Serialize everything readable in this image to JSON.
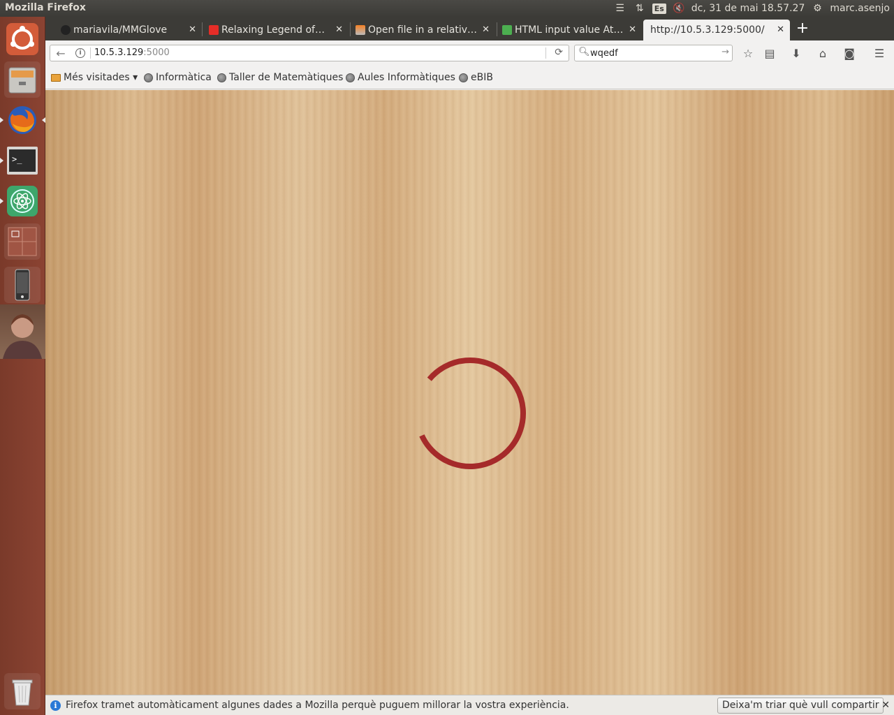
{
  "panel": {
    "app_title": "Mozilla Firefox",
    "language": "Es",
    "clock": "dc, 31 de mai 18.57.27",
    "user": "marc.asenjo"
  },
  "launcher": {
    "items": [
      "Ubuntu Dash",
      "Files",
      "Firefox",
      "Terminal",
      "Atom",
      "Workspace Switcher",
      "Device",
      "User Photo",
      "Trash"
    ]
  },
  "tabs": [
    {
      "label": "mariavila/MMGlove",
      "icon": "github-icon"
    },
    {
      "label": "Relaxing Legend of Zelda",
      "icon": "youtube-icon"
    },
    {
      "label": "Open file in a relativ…",
      "icon": "stackoverflow-icon"
    },
    {
      "label": "HTML input value At…",
      "icon": "w3schools-icon"
    },
    {
      "label": "http://10.5.3.129:5000/",
      "icon": "",
      "active": true
    }
  ],
  "navbar": {
    "url_host": "10.5.3.129",
    "url_port": ":5000",
    "search_value": "wqedf"
  },
  "bookmarks": [
    {
      "label": "Més visitades ▾",
      "icon": "folder-icon"
    },
    {
      "label": "Informàtica",
      "icon": "globe-icon"
    },
    {
      "label": "Taller de Matemàtiques",
      "icon": "globe-icon"
    },
    {
      "label": "Aules Informàtiques",
      "icon": "globe-icon"
    },
    {
      "label": "eBIB",
      "icon": "globe-icon"
    }
  ],
  "page": {
    "spinner_color": "#a52a2a",
    "spinner_progress": 0.82
  },
  "notification": {
    "message": "Firefox tramet automàticament algunes dades a Mozilla perquè puguem millorar la vostra experiència.",
    "button_label": "Deixa'm triar què vull compartir"
  },
  "colors": {
    "launcher_bg": "#8b4332",
    "panel_bg": "#3c3b37",
    "spinner": "#a52a2a"
  }
}
